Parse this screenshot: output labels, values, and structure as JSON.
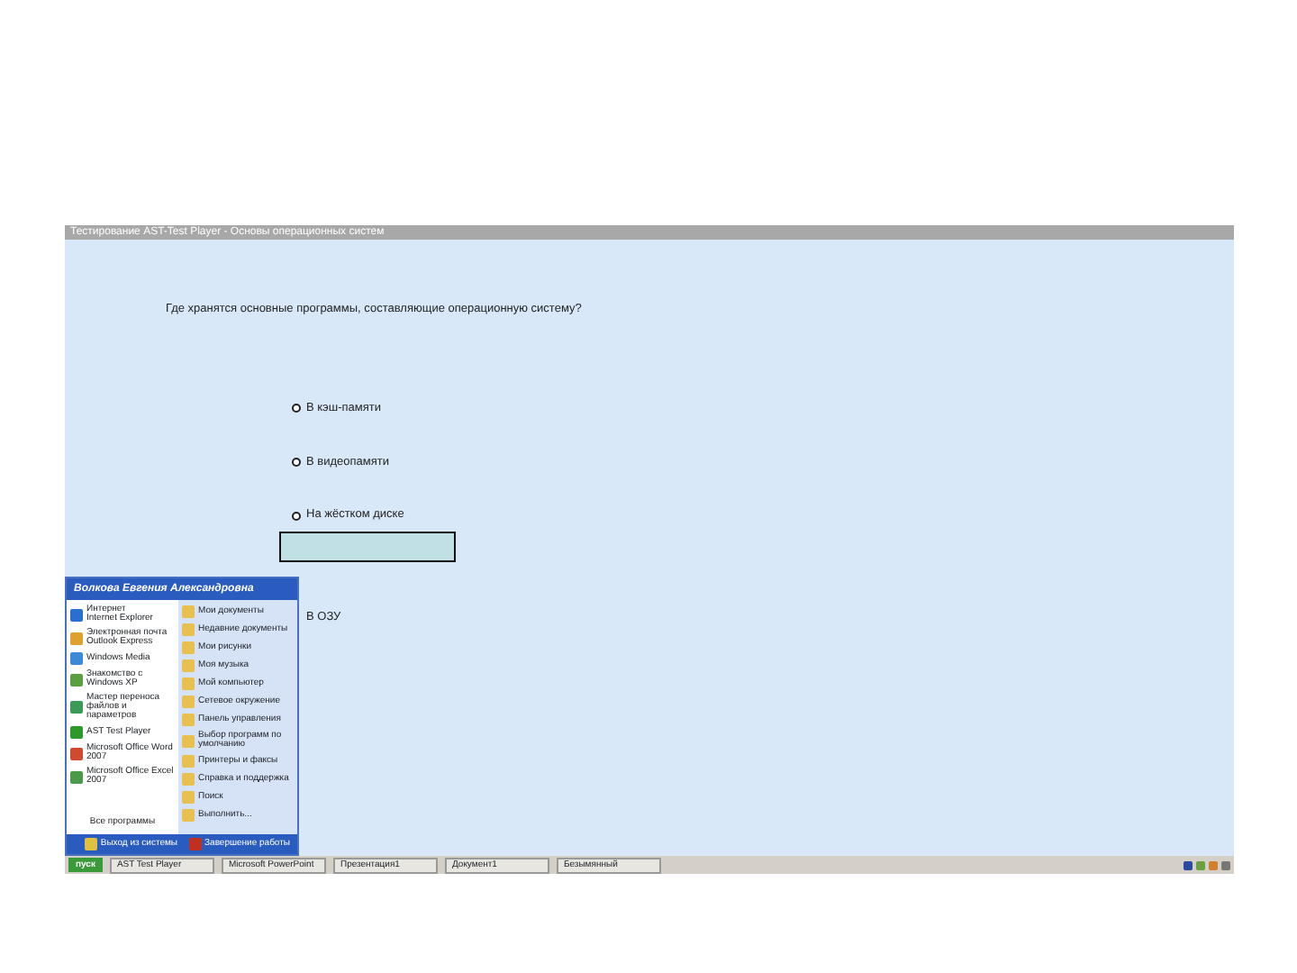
{
  "window": {
    "title": "Тестирование AST-Test Player - Основы операционных систем"
  },
  "question": {
    "text": "Где хранятся основные программы, составляющие операционную систему?"
  },
  "options": [
    {
      "label": "В кэш-памяти",
      "selected": false
    },
    {
      "label": "В видеопамяти",
      "selected": false
    },
    {
      "label": "На жёстком диске",
      "selected": false
    },
    {
      "label": "В ОЗУ"
    }
  ],
  "cover_box": {
    "shown": true
  },
  "start_menu": {
    "user": "Волкова Евгения Александровна",
    "left_items": [
      {
        "title": "Интернет",
        "subtitle": "Internet Explorer",
        "color": "#2a6fd0"
      },
      {
        "title": "Электронная почта",
        "subtitle": "Outlook Express",
        "color": "#e0a030"
      },
      {
        "title": "Windows Media",
        "color": "#3a8ad8"
      },
      {
        "title": "Знакомство с Windows XP",
        "color": "#5aa040"
      },
      {
        "title": "Мастер переноса файлов и",
        "subtitle": "параметров",
        "color": "#3a9a5a"
      },
      {
        "title": "AST Test Player",
        "color": "#2a9a2a"
      },
      {
        "title": "Microsoft Office Word",
        "subtitle": "2007",
        "color": "#d04a30"
      },
      {
        "title": "Microsoft Office Excel 2007",
        "color": "#4a9a4a"
      }
    ],
    "all_programs": "Все программы",
    "right_items": [
      "Мои документы",
      "Недавние документы",
      "Мои рисунки",
      "Моя музыка",
      "Мой компьютер",
      "Сетевое окружение",
      "Панель управления",
      "Выбор программ по умолчанию",
      "Принтеры и факсы",
      "Справка и поддержка",
      "Поиск",
      "Выполнить..."
    ],
    "logoff": "Выход из системы",
    "shutdown": "Завершение работы"
  },
  "taskbar": {
    "start": "пуск",
    "tasks": [
      "AST Test Player",
      "Microsoft PowerPoint",
      "Презентация1",
      "Документ1",
      "Безымянный"
    ]
  }
}
